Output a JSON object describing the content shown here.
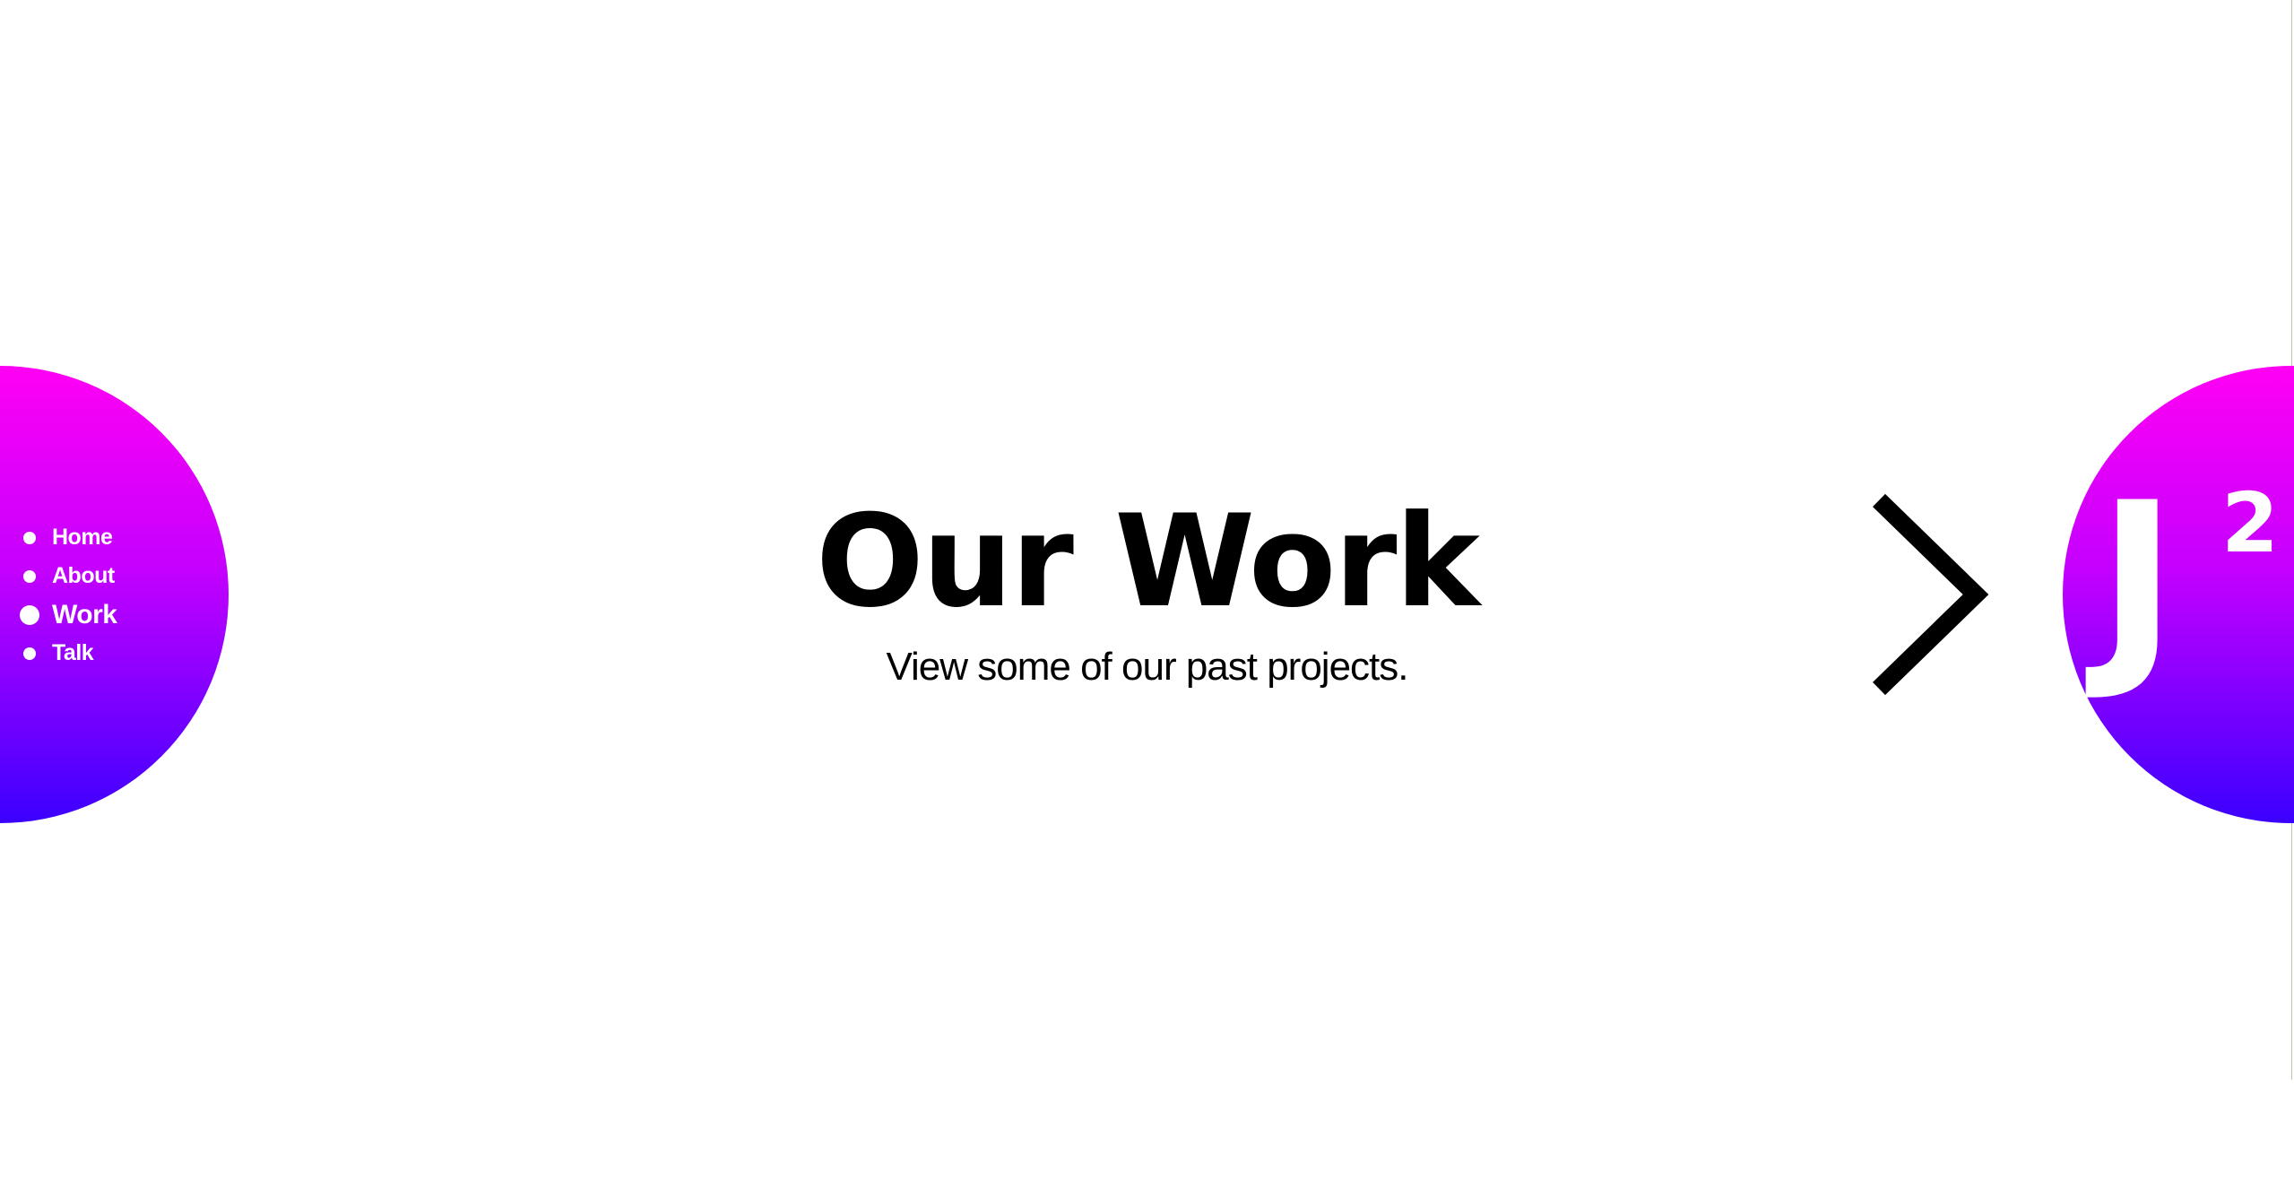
{
  "nav": {
    "items": [
      {
        "label": "Home",
        "active": false
      },
      {
        "label": "About",
        "active": false
      },
      {
        "label": "Work",
        "active": true
      },
      {
        "label": "Talk",
        "active": false
      }
    ]
  },
  "hero": {
    "title": "Our Work",
    "subtitle": "View some of our past projects."
  },
  "logo": {
    "letter": "J",
    "superscript": "2"
  },
  "icons": {
    "next": "chevron-right-icon"
  },
  "colors": {
    "gradient_top": "#ff00f4",
    "gradient_mid": "#c400ff",
    "gradient_bottom": "#3b00ff",
    "text": "#000000",
    "nav_text": "#ffffff",
    "background": "#ffffff"
  }
}
